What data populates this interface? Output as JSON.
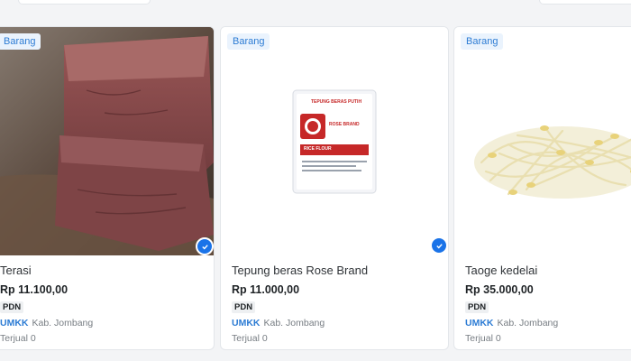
{
  "products": [
    {
      "badge": "Barang",
      "name": "Terasi",
      "price": "Rp 11.100,00",
      "origin_tag": "PDN",
      "umkk_tag": "",
      "location": "",
      "sold": "",
      "verified": true
    },
    {
      "badge": "Barang",
      "name": "Tepung beras Rose Brand",
      "price": "Rp 11.000,00",
      "origin_tag": "PDN",
      "umkk_tag": "UMKK",
      "location": "Kab. Jombang",
      "sold": "Terjual 0",
      "verified": true,
      "package_text": {
        "brand_line": "TEPUNG BERAS PUTIH",
        "brand": "ROSE BRAND",
        "label": "RICE FLOUR"
      }
    },
    {
      "badge": "Barang",
      "name": "Taoge kedelai",
      "price": "Rp 35.000,00",
      "origin_tag": "PDN",
      "umkk_tag": "UMKK",
      "location": "Kab. Jombang",
      "sold": "Terjual 0",
      "verified": false
    }
  ],
  "card1_row2": {
    "umkk_tag": "UMKK",
    "location": "Kab. Jombang",
    "sold": "Terjual 0"
  },
  "colors": {
    "badge_text": "#2d7cd4",
    "umkk": "#2d7cd4",
    "verified": "#1a73e8"
  },
  "icons": [
    "verified-check-icon"
  ]
}
